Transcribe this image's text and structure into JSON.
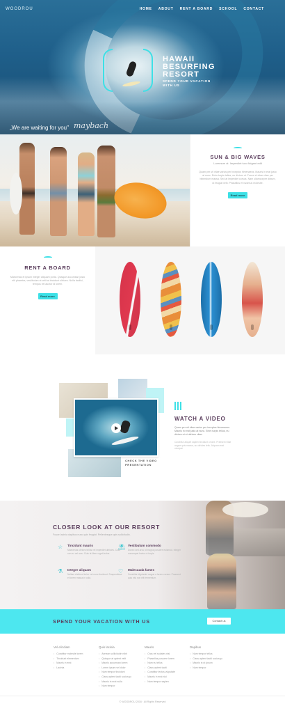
{
  "brand": {
    "logo": "WOODROU",
    "accent": "#3de0e6",
    "title_color": "#5a3d5c"
  },
  "nav": [
    "HOME",
    "ABOUT",
    "RENT A BOARD",
    "SCHOOL",
    "CONTACT"
  ],
  "hero": {
    "title_lines": [
      "HAWAII",
      "BESURFING",
      "RESORT"
    ],
    "subtitle": "SPEND YOUR VACATION WITH US",
    "tagline": "„We are waiting for you\"",
    "signature": "maybach"
  },
  "sun": {
    "title": "SUN & BIG WAVES",
    "subtitle": "Loremum ut. Imperdiet turo ficigant edit",
    "paragraph": "Quam per uti vitae varius per inceptos himenaeos. Mauris in erat justo at nunc. Enim turpis tellus, eu dictum ut. Fusce et vitae vitae per bibendum massa. Sed at imperdiet cursus. Nam ullamcorper dictum, ut feugiat velit. Phasellus et vivamus molestie.",
    "button": "Read more"
  },
  "rent": {
    "title": "RENT A BOARD",
    "paragraph": "Maecenas et ipsum integer aliquam porta. Quisque accumsan justo elit pharetra, vestibulum ut velit at tincidunt ultrices. Nulla facilisi, tempus vel auctor id lorem.",
    "button": "Read more"
  },
  "video": {
    "title": "WATCH A VIDEO",
    "paragraph": "Quam per uti vitae varius per inceptos himenaeos. Mauris in erat justo at nunc. Enim turpis tellus, eu dictum ut et ultrices vitae.",
    "paragraph2": "Curabitur aliquet sapien tincidunt ornare. Praesent vitae augue quis massa, ac ultricies felis. Aliquam erat volutpat.",
    "caption": "CHECK THE VIDEO PRESENTATION"
  },
  "closer": {
    "title": "CLOSER LOOK AT OUR RESORT",
    "subtitle": "Fusce lacinia dapibus nunc quis feugiat. Pellentesque quis sollicitudin.",
    "features": [
      {
        "icon": "star-icon",
        "glyph": "☆",
        "title": "Tincidunt mauris",
        "text": "Maecenas ultrices tellus vel imperdiet ultricies. Cras non ex vel arcu. Duis at libero eget lectus."
      },
      {
        "icon": "beach-icon",
        "glyph": "⛱",
        "title": "Vestibulum commodo",
        "text": "Donec sed arcu id magna posuere euismod. Integer consequat lectus ut turpis."
      },
      {
        "icon": "lab-icon",
        "glyph": "⚗",
        "title": "Integer aliquam",
        "text": "Nullam eleifend tortor vel nunc tincidunt. Suspendisse et lorem massa in odio."
      },
      {
        "icon": "heart-icon",
        "glyph": "♡",
        "title": "Malesuada fames",
        "text": "Curabitur dignissim augue a lorem cursus. Praesent quis nisl non elit fermentum."
      }
    ]
  },
  "cta": {
    "title": "SPEND YOUR VACATION WITH US",
    "button": "Contact us"
  },
  "footer": {
    "columns": [
      {
        "heading": "Vel elit diam",
        "items": [
          "Curabitur molestie lorem",
          "Tincidunt elementum",
          "Mauris in erat",
          "Lacinia"
        ]
      },
      {
        "heading": "Quis lacinia",
        "items": [
          "Aenean sollicitudin nibh",
          "Quisque at aptent velit",
          "Mauris accumsan lorem",
          "Lorem ipsum vel dolor",
          "Nam tempor tincidunt",
          "Class aptent taciti sociosqu",
          "Mauris in erat nulla",
          "Nam tempor"
        ]
      },
      {
        "heading": "Mauris",
        "items": [
          "Cras vel sodales nisl",
          "Phasellus posuere lorem",
          "Nam eu tellus",
          "Class aptent taciti",
          "Curabitur lectus vulputate",
          "Mauris in erat nisi",
          "Nam tempor sapien"
        ]
      },
      {
        "heading": "Dapibus",
        "items": [
          "Nam tempor tellus",
          "Class aptent taciti sociosqu",
          "Mauris in ut ipsum",
          "Nam tempor"
        ]
      }
    ],
    "copyright": "© WOODROU 2016 · All Rights Reserved"
  }
}
